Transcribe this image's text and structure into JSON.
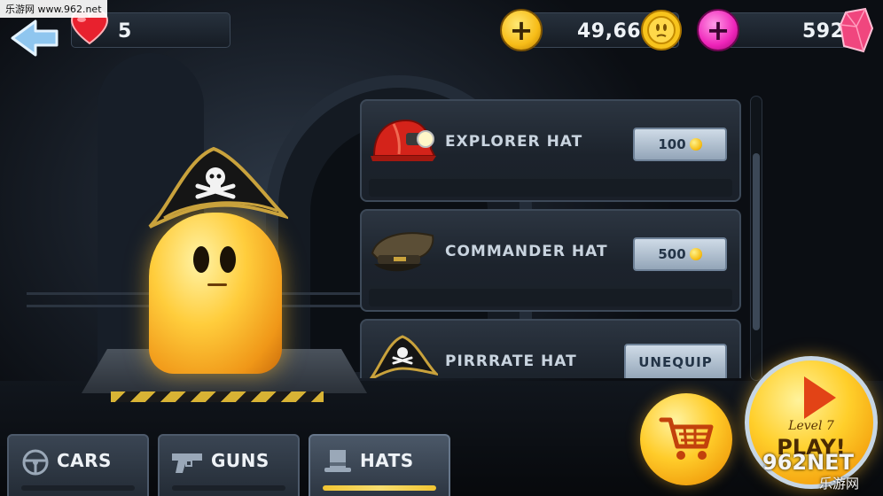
{
  "hud": {
    "lives": "5",
    "coins": "49,662",
    "gems": "592",
    "add_coins_symbol": "+",
    "add_gems_symbol": "+",
    "colors": {
      "coin": "#f7bc17",
      "gem": "#ef24ba",
      "heart": "#e8212e"
    }
  },
  "shop": {
    "items": [
      {
        "name": "EXPLORER HAT",
        "price": "100",
        "icon": "miner-helmet-icon",
        "state": "buy"
      },
      {
        "name": "COMMANDER HAT",
        "price": "500",
        "icon": "officer-cap-icon",
        "state": "buy"
      },
      {
        "name": "PIRRRATE HAT",
        "action": "UNEQUIP",
        "icon": "pirate-hat-icon",
        "state": "equipped"
      }
    ]
  },
  "tabs": [
    {
      "label": "CARS",
      "icon": "steering-wheel-icon",
      "active": false
    },
    {
      "label": "GUNS",
      "icon": "pistol-icon",
      "active": false
    },
    {
      "label": "HATS",
      "icon": "top-hat-icon",
      "active": true
    }
  ],
  "play": {
    "level": "Level 7",
    "label": "PLAY!"
  },
  "watermarks": {
    "top_left": "乐游网 www.962.net",
    "bottom_right_main": "962NET",
    "bottom_right_sub": "乐游网"
  }
}
